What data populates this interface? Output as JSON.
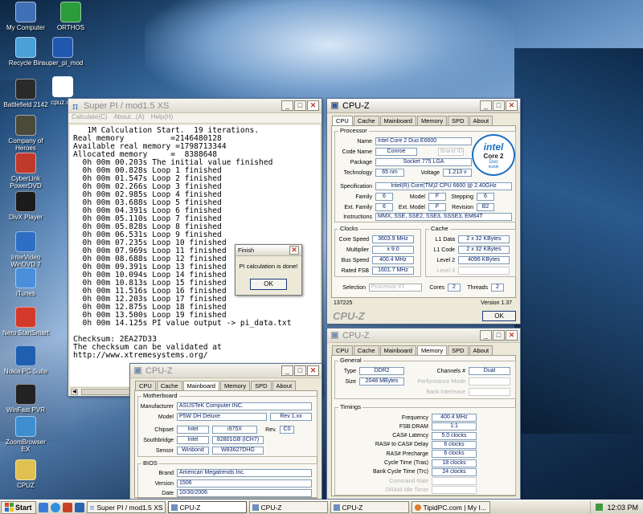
{
  "desktop": {
    "icons": [
      {
        "label": "My Computer",
        "color": "#3f6fb5"
      },
      {
        "label": "ORTHOS",
        "color": "#2a9d3a"
      },
      {
        "label": "Recycle Bin",
        "color": "#4aa0d8"
      },
      {
        "label": "super_pi_mod",
        "color": "#2058b0"
      },
      {
        "label": "Battlefield 2142",
        "color": "#2a2a2a"
      },
      {
        "label": "cpuz.cvf",
        "color": "#ffffff"
      },
      {
        "label": "Company of Heroes",
        "color": "#4a4a3a"
      },
      {
        "label": "CyberLink PowerDVD",
        "color": "#c0392b"
      },
      {
        "label": "DivX Player",
        "color": "#1b1b1b"
      },
      {
        "label": "InterVideo WinDVD 7",
        "color": "#2d6fc4"
      },
      {
        "label": "iTunes",
        "color": "#4a8fdb"
      },
      {
        "label": "Nero StartSmart",
        "color": "#d33a2a"
      },
      {
        "label": "Nokia PC Suite",
        "color": "#1f5fb0"
      },
      {
        "label": "WinFast PVR",
        "color": "#222222"
      },
      {
        "label": "ZoomBrowser EX",
        "color": "#3f8fd0"
      },
      {
        "label": "CPUZ",
        "color": "#e0c050"
      }
    ]
  },
  "superpi": {
    "title": "Super PI / mod1.5 XS",
    "menu": [
      "Calculate(C)",
      "About...(A)",
      "Help(H)"
    ],
    "lines": [
      "   1M Calculation Start.  19 iterations.",
      "Real memory          =2146480128",
      "Available real memory =1798713344",
      "Allocated memory     =  8388648",
      "  0h 00m 00.203s The initial value finished",
      "  0h 00m 00.828s Loop 1 finished",
      "  0h 00m 01.547s Loop 2 finished",
      "  0h 00m 02.266s Loop 3 finished",
      "  0h 00m 02.985s Loop 4 finished",
      "  0h 00m 03.688s Loop 5 finished",
      "  0h 00m 04.391s Loop 6 finished",
      "  0h 00m 05.110s Loop 7 finished",
      "  0h 00m 05.828s Loop 8 finished",
      "  0h 00m 06.531s Loop 9 finished",
      "  0h 00m 07.235s Loop 10 finished",
      "  0h 00m 07.969s Loop 11 finished",
      "  0h 00m 08.688s Loop 12 finished",
      "  0h 00m 09.391s Loop 13 finished",
      "  0h 00m 10.094s Loop 14 finished",
      "  0h 00m 10.813s Loop 15 finished",
      "  0h 00m 11.516s Loop 16 finished",
      "  0h 00m 12.203s Loop 17 finished",
      "  0h 00m 12.875s Loop 18 finished",
      "  0h 00m 13.500s Loop 19 finished",
      "  0h 00m 14.125s PI value output -> pi_data.txt",
      "",
      "Checksum: 2EA27D33",
      "The checksum can be validated at",
      "http://www.xtremesystems.org/"
    ]
  },
  "finish_dialog": {
    "title": "Finish",
    "message": "PI calculation is done!",
    "ok": "OK"
  },
  "cpuz_cpu": {
    "title": "CPU-Z",
    "tabs": [
      "CPU",
      "Cache",
      "Mainboard",
      "Memory",
      "SPD",
      "About"
    ],
    "processor_label": "Processor",
    "fields": {
      "name_l": "Name",
      "name": "Intel Core 2 Duo E6600",
      "codename_l": "Code Name",
      "codename": "Conroe",
      "brandid_l": "Brand ID",
      "package_l": "Package",
      "package": "Socket 775 LGA",
      "technology_l": "Technology",
      "technology": "65 nm",
      "voltage_l": "Voltage",
      "voltage": "1.213 v",
      "spec_l": "Specification",
      "spec": "Intel(R) Core(TM)2 CPU        6600  @ 2.40GHz",
      "family_l": "Family",
      "family": "6",
      "model_l": "Model",
      "model": "F",
      "stepping_l": "Stepping",
      "stepping": "6",
      "extfamily_l": "Ext. Family",
      "extfamily": "6",
      "extmodel_l": "Ext. Model",
      "extmodel": "F",
      "revision_l": "Revision",
      "revision": "B2",
      "instr_l": "Instructions",
      "instr": "MMX, SSE, SSE2, SSE3, SSSE3, EM64T"
    },
    "clocks_label": "Clocks",
    "clocks": {
      "corespeed_l": "Core Speed",
      "corespeed": "3603.9 MHz",
      "multiplier_l": "Multiplier",
      "multiplier": "x 9.0",
      "busspeed_l": "Bus Speed",
      "busspeed": "400.4 MHz",
      "ratedfsb_l": "Rated FSB",
      "ratedfsb": "1601.7 MHz"
    },
    "cache_label": "Cache",
    "cache": {
      "l1data_l": "L1 Data",
      "l1data": "2 x 32 KBytes",
      "l1code_l": "L1 Code",
      "l1code": "2 x 32 KBytes",
      "level2_l": "Level 2",
      "level2": "4096 KBytes",
      "level3_l": "Level 3"
    },
    "selection_l": "Selection",
    "selection": "Processor #1",
    "cores_l": "Cores",
    "cores": "2",
    "threads_l": "Threads",
    "threads": "2",
    "id": "137225",
    "version": "Version 1.37",
    "ok": "OK",
    "logo_text": "CPU-Z",
    "intel_logo": {
      "word": "intel",
      "line1": "Core 2",
      "line2": "Duo",
      "line3": "inside"
    }
  },
  "cpuz_mem": {
    "title": "CPU-Z",
    "tabs": [
      "CPU",
      "Cache",
      "Mainboard",
      "Memory",
      "SPD",
      "About"
    ],
    "general_label": "General",
    "type_l": "Type",
    "type": "DDR2",
    "channels_l": "Channels #",
    "channels": "Dual",
    "size_l": "Size",
    "size": "2048 MBytes",
    "perfmode_l": "Performance Mode",
    "bankinter_l": "Bank Interleave",
    "timings_label": "Timings",
    "timings": [
      {
        "l": "Frequency",
        "v": "400.4 MHz"
      },
      {
        "l": "FSB:DRAM",
        "v": "1:1"
      },
      {
        "l": "CAS# Latency",
        "v": "5.0 clocks"
      },
      {
        "l": "RAS# to CAS# Delay",
        "v": "6 clocks"
      },
      {
        "l": "RAS# Precharge",
        "v": "6 clocks"
      },
      {
        "l": "Cycle Time (Tras)",
        "v": "18 clocks"
      },
      {
        "l": "Bank Cycle Time (Trc)",
        "v": "24 clocks"
      },
      {
        "l": "Command Rate",
        "v": ""
      },
      {
        "l": "DRAM Idle Timer",
        "v": ""
      }
    ]
  },
  "cpuz_mb": {
    "title": "CPU-Z",
    "tabs": [
      "CPU",
      "Cache",
      "Mainboard",
      "Memory",
      "SPD",
      "About"
    ],
    "motherboard_label": "Motherboard",
    "manufacturer_l": "Manufacturer",
    "manufacturer": "ASUSTeK Computer INC.",
    "model_l": "Model",
    "model": "P5W DH Deluxe",
    "model_rev": "Rev 1.xx",
    "chipset_l": "Chipset",
    "chipset_vendor": "Intel",
    "chipset": "i975X",
    "rev_l": "Rev.",
    "rev": "C0",
    "southbridge_l": "Southbridge",
    "sb_vendor": "Intel",
    "southbridge": "82801GB (ICH7)",
    "sensor_l": "Sensor",
    "sensor_vendor": "Winbond",
    "sensor": "W83627DHG",
    "bios_label": "BIOS",
    "brand_l": "Brand",
    "brand": "American Megatrends Inc.",
    "version_l": "Version",
    "version": "1506",
    "date_l": "Date",
    "date": "10/30/2006"
  },
  "taskbar": {
    "start": "Start",
    "tasks": [
      "Super PI / mod1.5 XS",
      "CPU-Z",
      "CPU-Z",
      "CPU-Z",
      "TipidPC.com | My I..."
    ],
    "clock": "12:03 PM"
  }
}
